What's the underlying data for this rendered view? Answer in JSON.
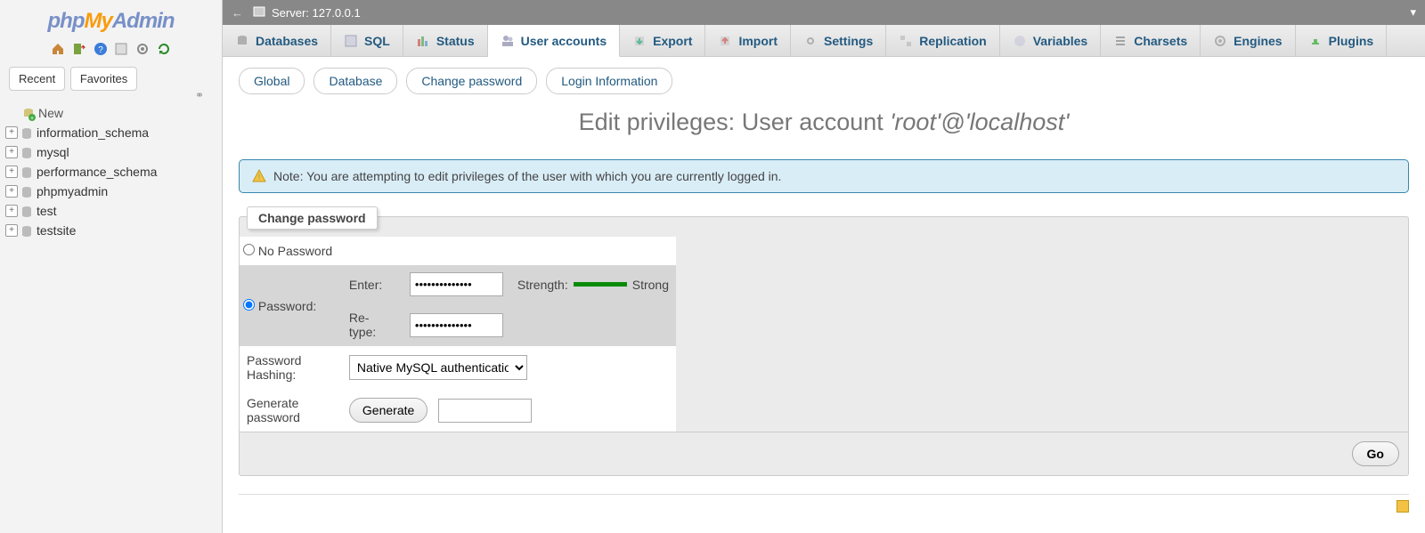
{
  "logo": {
    "php": "php",
    "my": "My",
    "admin": "Admin"
  },
  "sidebar_tabs": {
    "recent": "Recent",
    "favorites": "Favorites"
  },
  "tree": {
    "new": "New",
    "dbs": [
      "information_schema",
      "mysql",
      "performance_schema",
      "phpmyadmin",
      "test",
      "testsite"
    ]
  },
  "server": {
    "label": "Server:",
    "host": "127.0.0.1"
  },
  "tabs": {
    "databases": "Databases",
    "sql": "SQL",
    "status": "Status",
    "user_accounts": "User accounts",
    "export": "Export",
    "import": "Import",
    "settings": "Settings",
    "replication": "Replication",
    "variables": "Variables",
    "charsets": "Charsets",
    "engines": "Engines",
    "plugins": "Plugins"
  },
  "subtabs": {
    "global": "Global",
    "database": "Database",
    "change_password": "Change password",
    "login_info": "Login Information"
  },
  "title": {
    "prefix": "Edit privileges: User account ",
    "account": "'root'@'localhost'"
  },
  "notice": "Note: You are attempting to edit privileges of the user with which you are currently logged in.",
  "form": {
    "legend": "Change password",
    "no_password": "No Password",
    "password_label": "Password:",
    "enter": "Enter:",
    "retype": "Re-type:",
    "pw_value": "••••••••••••••",
    "retype_value": "••••••••••••••",
    "strength_label": "Strength:",
    "strength_value": "Strong",
    "hashing_label": "Password Hashing:",
    "hashing_option": "Native MySQL authentication",
    "generate_label": "Generate password",
    "generate_btn": "Generate",
    "generate_value": ""
  },
  "go": "Go",
  "colors": {
    "link": "#235a81",
    "strength": "#0a8a0a"
  }
}
